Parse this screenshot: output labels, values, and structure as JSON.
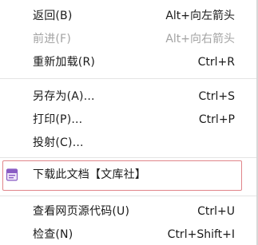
{
  "menu": {
    "items": [
      {
        "label": "返回(B)",
        "shortcut": "Alt+向左箭头"
      },
      {
        "label": "前进(F)",
        "shortcut": "Alt+向右箭头",
        "disabled": true
      },
      {
        "label": "重新加载(R)",
        "shortcut": "Ctrl+R"
      },
      {
        "label": "另存为(A)...",
        "shortcut": "Ctrl+S"
      },
      {
        "label": "打印(P)...",
        "shortcut": "Ctrl+P"
      },
      {
        "label": "投射(C)..."
      },
      {
        "label": "下载此文档【文库社】",
        "icon": "document-download-icon"
      },
      {
        "label": "查看网页源代码(U)",
        "shortcut": "Ctrl+U"
      },
      {
        "label": "检查(N)",
        "shortcut": "Ctrl+Shift+I"
      }
    ]
  },
  "colors": {
    "highlight_border": "#e0858a",
    "disabled_text": "#a3a3a3",
    "icon_accent": "#8a5cc4"
  }
}
